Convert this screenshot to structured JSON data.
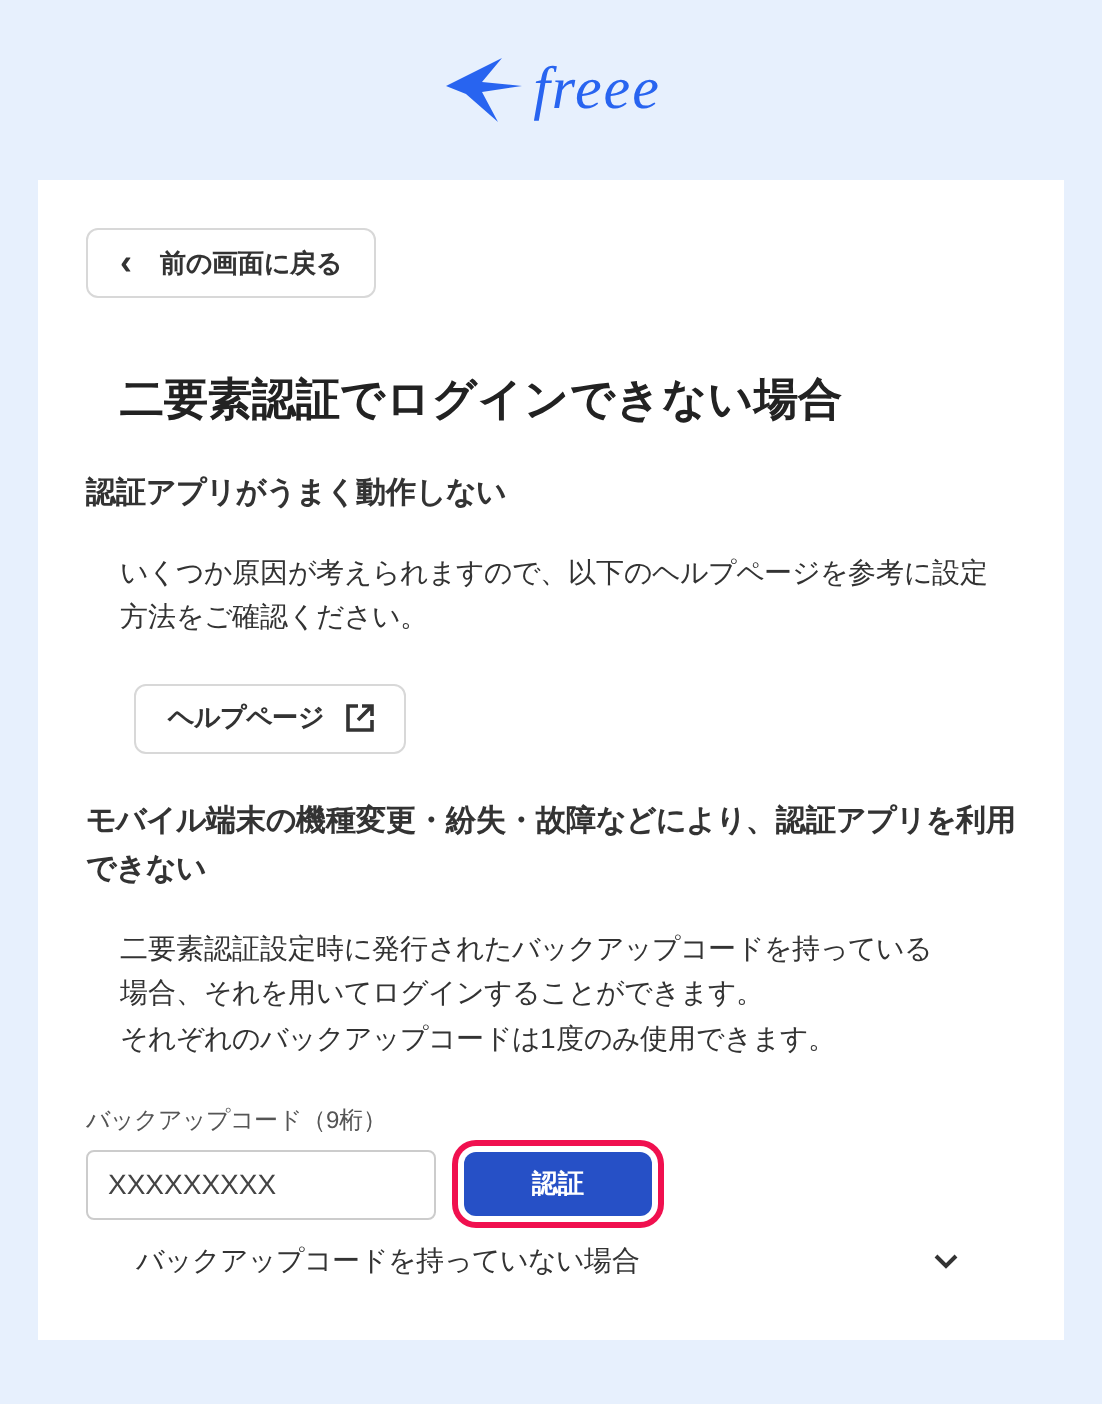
{
  "logo": {
    "text": "freee"
  },
  "back_button": {
    "label": "前の画面に戻る",
    "icon": "‹"
  },
  "title": "二要素認証でログインできない場合",
  "sections": [
    {
      "heading": "認証アプリがうまく動作しない",
      "paragraphs": [
        "いくつか原因が考えられますので、以下のヘルプページを参考に設定方法をご確認ください。"
      ],
      "link_button": {
        "label": "ヘルプページ"
      }
    },
    {
      "heading": "モバイル端末の機種変更・紛失・故障などにより、認証アプリを利用できない",
      "paragraphs": [
        "二要素認証設定時に発行されたバックアップコードを持っている場合、それを用いてログインすることができます。",
        "それぞれのバックアップコードは1度のみ使用できます。"
      ],
      "field": {
        "label": "バックアップコード（9桁）",
        "placeholder": "XXXXXXXXX"
      },
      "submit_button": {
        "label": "認証",
        "focused": true
      },
      "expander": {
        "label": "バックアップコードを持っていない場合",
        "expanded": false
      }
    }
  ]
}
